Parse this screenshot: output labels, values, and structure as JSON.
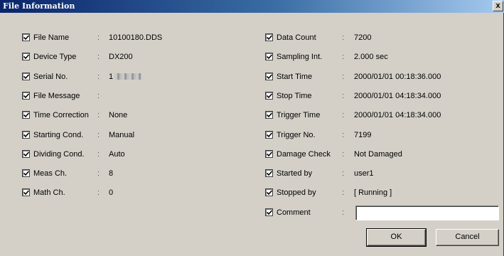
{
  "window": {
    "title": "File Information",
    "close_label": "x"
  },
  "left_fields": [
    {
      "label": "File Name",
      "value": "10100180.DDS"
    },
    {
      "label": "Device Type",
      "value": "DX200"
    },
    {
      "label": "Serial No.",
      "value": "1"
    },
    {
      "label": "File Message",
      "value": ""
    },
    {
      "label": "Time Correction",
      "value": "None"
    },
    {
      "label": "Starting Cond.",
      "value": "Manual"
    },
    {
      "label": "Dividing Cond.",
      "value": "Auto"
    },
    {
      "label": "Meas Ch.",
      "value": "8"
    },
    {
      "label": "Math Ch.",
      "value": "0"
    }
  ],
  "right_fields": [
    {
      "label": "Data Count",
      "value": "7200"
    },
    {
      "label": "Sampling Int.",
      "value": "2.000 sec"
    },
    {
      "label": "Start Time",
      "value": "2000/01/01 00:18:36.000"
    },
    {
      "label": "Stop Time",
      "value": "2000/01/01 04:18:34.000"
    },
    {
      "label": "Trigger Time",
      "value": "2000/01/01 04:18:34.000"
    },
    {
      "label": "Trigger No.",
      "value": "7199"
    },
    {
      "label": "Damage Check",
      "value": "Not Damaged"
    },
    {
      "label": "Started by",
      "value": "user1"
    },
    {
      "label": "Stopped by",
      "value": "[ Running ]"
    },
    {
      "label": "Comment",
      "value": ""
    }
  ],
  "colon": ":",
  "buttons": {
    "ok": "OK",
    "cancel": "Cancel"
  }
}
